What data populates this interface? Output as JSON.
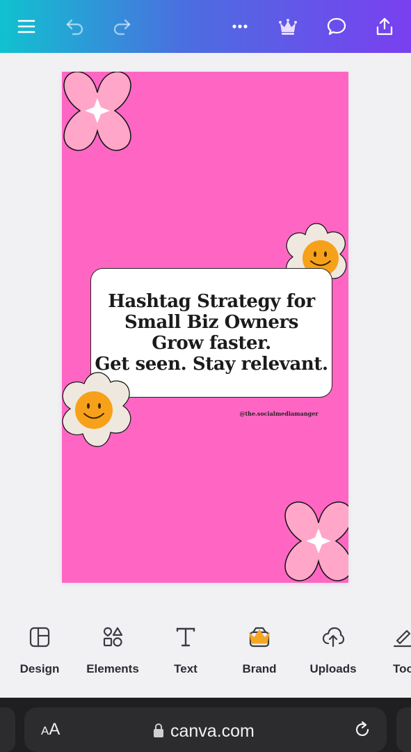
{
  "toolbar": {
    "icons": [
      "menu-icon",
      "undo-icon",
      "redo-icon",
      "more-icon",
      "crown-icon",
      "comment-icon",
      "share-icon"
    ]
  },
  "design": {
    "headline_lines": [
      "Hashtag Strategy for",
      "Small Biz Owners",
      "Grow faster.",
      "Get seen. Stay relevant."
    ],
    "handle": "@the.socialmediamanger",
    "colors": {
      "background": "#ff66c4",
      "flower_pink": "#ffa6c9",
      "daisy": "#efe8de",
      "smiley": "#f7a11a"
    }
  },
  "dock": {
    "items": [
      {
        "label": "Design",
        "icon": "layout-icon"
      },
      {
        "label": "Elements",
        "icon": "shapes-icon"
      },
      {
        "label": "Text",
        "icon": "text-icon"
      },
      {
        "label": "Brand",
        "icon": "brand-icon"
      },
      {
        "label": "Uploads",
        "icon": "cloud-upload-icon"
      },
      {
        "label": "Too",
        "icon": "tools-icon"
      }
    ]
  },
  "browser": {
    "text_size_label_small": "A",
    "text_size_label_large": "A",
    "url": "canva.com"
  }
}
